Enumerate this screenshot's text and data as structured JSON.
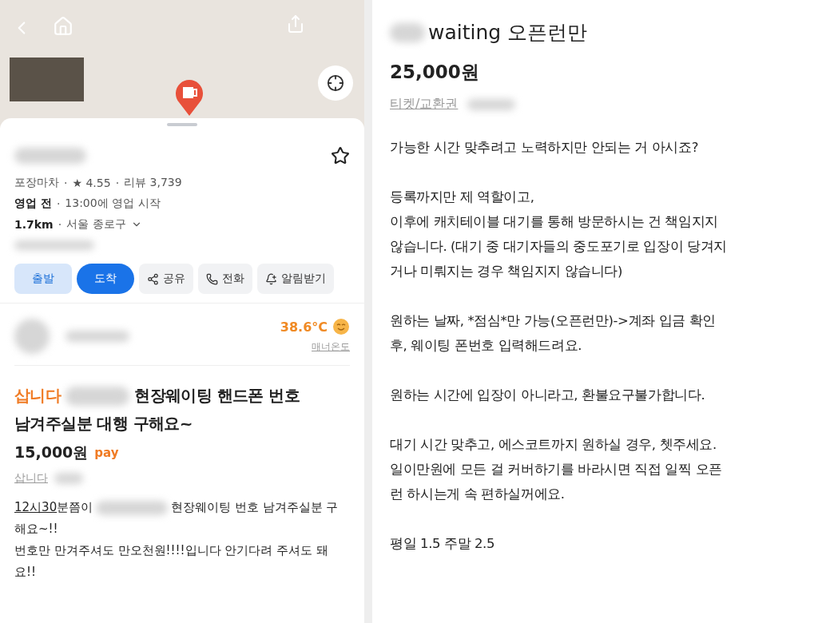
{
  "map_screen": {
    "favorite": false,
    "place": {
      "category": "포장마차",
      "rating": "★ 4.55",
      "separator": "·",
      "reviews": "리뷰 3,739",
      "status": "영업 전",
      "hours": "13:00에 영업 시작",
      "distance": "1.7km",
      "region": "서울 종로구"
    },
    "actions": [
      {
        "label": "출발",
        "kind": "depart",
        "selected": false
      },
      {
        "label": "도착",
        "kind": "arrive",
        "selected": true
      },
      {
        "label": "공유",
        "kind": "share",
        "selected": false
      },
      {
        "label": "전화",
        "kind": "call",
        "selected": false
      },
      {
        "label": "알림받기",
        "kind": "notify",
        "selected": false
      }
    ]
  },
  "listing": {
    "temperature": "38.6°C",
    "temperature_label": "매너온도",
    "title_prefix": "삽니다",
    "title_lines": [
      "현장웨이팅 핸드폰 번호",
      "남겨주실분 대행 구해요~"
    ],
    "price": "15,000원",
    "pay": "pay",
    "category": "삽니다",
    "body_link": "12시30",
    "body_lead": "분쯤이",
    "body_rest": "현장웨이팅 번호 남겨주실분 구",
    "body_lines": [
      "해요~!!",
      "번호만 만겨주셔도 만오천원!!!!입니다 안기다려 주셔도 돼",
      "요!!"
    ]
  },
  "post": {
    "title": "waiting 오픈런만",
    "price": "25,000원",
    "category": "티켓/교환권",
    "paragraphs": [
      [
        "가능한 시간 맞추려고 노력하지만 안되는 거 아시죠?"
      ],
      [
        "등록까지만 제 역할이고,",
        "이후에 캐치테이블 대기를 통해 방문하시는 건 책임지지",
        "않습니다. (대기 중 대기자들의 중도포기로 입장이 당겨지",
        "거나 미뤄지는 경우 책임지지 않습니다)"
      ],
      [
        "원하는 날짜, *점심*만 가능(오픈런만)->계좌 입금 확인",
        "후, 웨이팅 폰번호 입력해드려요."
      ],
      [
        "원하는 시간에 입장이 아니라고, 환불요구불가합니다."
      ],
      [
        "대기 시간 맞추고, 에스코트까지 원하실 경우, 쳇주세요.",
        "일이만원에 모든 걸 커버하기를 바라시면 직접 일찍 오픈",
        "런 하시는게 속 편하실꺼에요."
      ],
      [
        "평일 1.5 주말 2.5"
      ]
    ]
  }
}
